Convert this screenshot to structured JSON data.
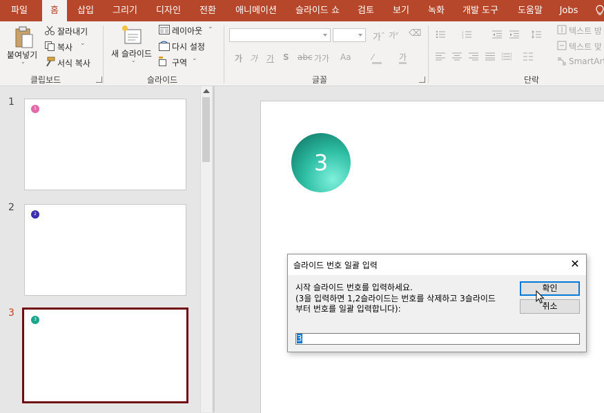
{
  "ribbon_tabs": [
    "파일",
    "홈",
    "삽입",
    "그리기",
    "디자인",
    "전환",
    "애니메이션",
    "슬라이드 쇼",
    "검토",
    "보기",
    "녹화",
    "개발 도구",
    "도움말",
    "Jobs"
  ],
  "active_tab": "홈",
  "clipboard": {
    "paste_label": "붙여넣기",
    "cut_label": "잘라내기",
    "copy_label": "복사",
    "format_painter_label": "서식 복사",
    "group_label": "클립보드"
  },
  "slides_group": {
    "new_slide_label": "새 슬라이드",
    "layout_label": "레이아웃",
    "reset_label": "다시 설정",
    "section_label": "구역",
    "group_label": "슬라이드"
  },
  "font_group": {
    "group_label": "글꼴",
    "row2_labels": [
      "가",
      "가",
      "가",
      "S",
      "가가",
      "Aa",
      "가"
    ]
  },
  "paragraph_group": {
    "group_label": "단락",
    "text_direction_label": "텍스트 방",
    "align_text_label": "텍스트 맞",
    "smartart_label": "SmartArt"
  },
  "slide_thumbnails": [
    {
      "number": "1",
      "dot_text": "1",
      "dot_color": "#e26aa8"
    },
    {
      "number": "2",
      "dot_text": "2",
      "dot_color": "#3a2db0"
    },
    {
      "number": "3",
      "dot_text": "3",
      "dot_color": "#1aa58c",
      "selected": true
    }
  ],
  "slide_content": {
    "circle_number": "3"
  },
  "dialog": {
    "title": "슬라이드 번호 일괄 입력",
    "close_glyph": "✕",
    "message_line1": "시작 슬라이드 번호를 입력하세요.",
    "message_line2": "(3을 입력하면 1,2슬라이드는 번호를 삭제하고 3슬라이드",
    "message_line3": "부터 번호를 일괄 입력합니다):",
    "ok_label": "확인",
    "cancel_label": "취소",
    "input_value": "3"
  },
  "colors": {
    "accent": "#b7472a",
    "selected_thumb_border": "#6e0a12"
  }
}
